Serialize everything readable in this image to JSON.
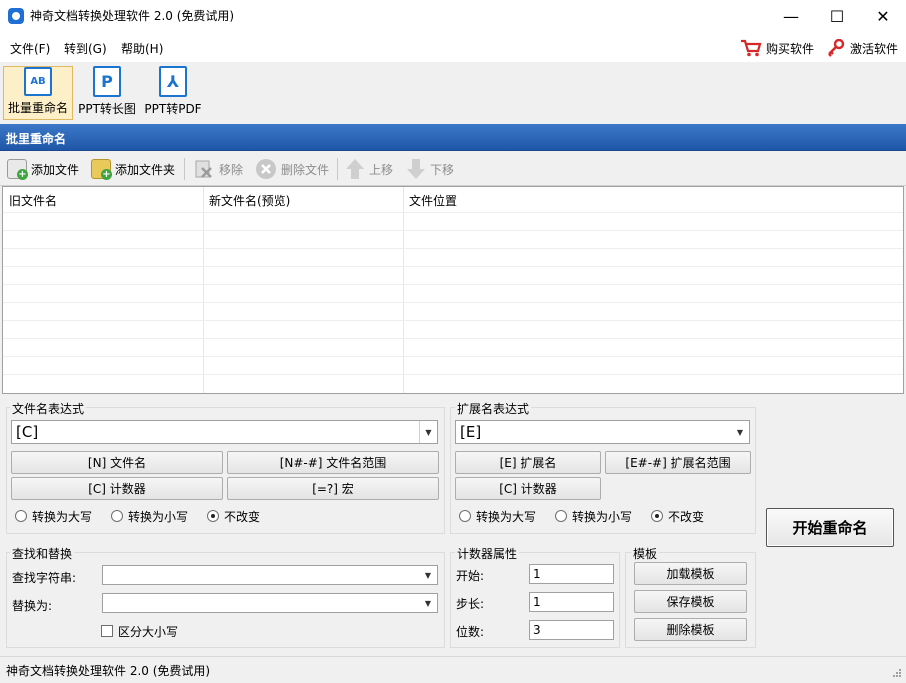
{
  "window": {
    "title": "神奇文档转换处理软件 2.0 (免费试用)",
    "controls": {
      "minimize": "—",
      "maximize": "☐",
      "close": "✕"
    }
  },
  "menu": {
    "items": [
      "文件(F)",
      "转到(G)",
      "帮助(H)"
    ],
    "buy": "购买软件",
    "activate": "激活软件"
  },
  "toolbar": {
    "tools": [
      {
        "label": "批量重命名",
        "icon": "rename-icon",
        "glyph": "AB",
        "active": true
      },
      {
        "label": "PPT转长图",
        "icon": "ppt-long-image-icon",
        "glyph": "P",
        "active": false
      },
      {
        "label": "PPT转PDF",
        "icon": "ppt-pdf-icon",
        "glyph": "⅄",
        "active": false
      }
    ]
  },
  "section": {
    "title": "批里重命名"
  },
  "subtoolbar": {
    "add_file": "添加文件",
    "add_folder": "添加文件夹",
    "remove": "移除",
    "delete_file": "删除文件",
    "move_up": "上移",
    "move_down": "下移"
  },
  "table": {
    "columns": [
      "旧文件名",
      "新文件名(预览)",
      "文件位置"
    ],
    "rows": []
  },
  "filename_expr": {
    "label": "文件名表达式",
    "value": "[C]",
    "buttons": [
      "[N] 文件名",
      "[N#-#] 文件名范围",
      "[C] 计数器",
      "[=?] 宏"
    ],
    "radios": [
      "转换为大写",
      "转换为小写",
      "不改变"
    ],
    "selected": 2
  },
  "ext_expr": {
    "label": "扩展名表达式",
    "value": "[E]",
    "buttons": [
      "[E] 扩展名",
      "[E#-#] 扩展名范围",
      "[C] 计数器"
    ],
    "radios": [
      "转换为大写",
      "转换为小写",
      "不改变"
    ],
    "selected": 2
  },
  "find_replace": {
    "label": "查找和替换",
    "find_label": "查找字符串:",
    "find_value": "",
    "replace_label": "替换为:",
    "replace_value": "",
    "case_label": "区分大小写"
  },
  "counter": {
    "label": "计数器属性",
    "start_label": "开始:",
    "start": "1",
    "step_label": "步长:",
    "step": "1",
    "digits_label": "位数:",
    "digits": "3"
  },
  "template": {
    "label": "模板",
    "load": "加载模板",
    "save": "保存模板",
    "delete": "删除模板"
  },
  "start_button": "开始重命名",
  "status": {
    "text": "神奇文档转换处理软件 2.0 (免费试用)"
  },
  "colors": {
    "section_header": "#1f56a8",
    "accent": "#1b74d0",
    "cart": "#d62828",
    "key": "#d62828"
  }
}
